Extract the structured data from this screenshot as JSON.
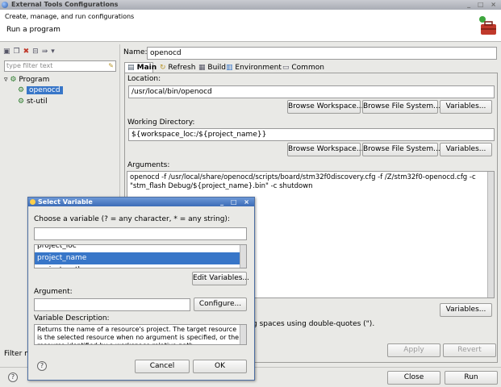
{
  "window": {
    "title": "External Tools Configurations",
    "controls": "_ □ ×"
  },
  "header": {
    "subtitle": "Create, manage, and run configurations",
    "title": "Run a program"
  },
  "left": {
    "filter_placeholder": "type filter text",
    "tree": [
      {
        "label": "Program"
      },
      {
        "label": "openocd"
      },
      {
        "label": "st-util"
      }
    ],
    "filter_status": "Filter m"
  },
  "right": {
    "name_label": "Name:",
    "name_value": "openocd",
    "tabs": [
      "Main",
      "Refresh",
      "Build",
      "Environment",
      "Common"
    ],
    "location_label": "Location:",
    "location_value": "/usr/local/bin/openocd",
    "browse_workspace_1": "Browse Workspace...",
    "browse_fs_1": "Browse File System...",
    "variables_1": "Variables...",
    "workdir_label": "Working Directory:",
    "workdir_value": "${workspace_loc:/${project_name}}",
    "browse_workspace_2": "Browse Workspace...",
    "browse_fs_2": "Browse File System...",
    "variables_2": "Variables...",
    "arguments_label": "Arguments:",
    "arguments_line1": "openocd -f /usr/local/share/openocd/scripts/board/stm32f0discovery.cfg -f  /Z/stm32f0-openocd.cfg -c",
    "arguments_line2": "\"stm_flash  Debug/${project_name}.bin\" -c shutdown",
    "variables_3": "Variables...",
    "quote_note": "g spaces using double-quotes (\").",
    "apply": "Apply",
    "revert": "Revert",
    "close": "Close",
    "run": "Run"
  },
  "dialog": {
    "title": "Select Variable",
    "controls": "_ □ ×",
    "choose_label": "Choose a variable (? = any character, * = any string):",
    "search_value": "",
    "variables": [
      "project_loc",
      "project_name",
      "project_path"
    ],
    "edit_variables": "Edit Variables...",
    "argument_label": "Argument:",
    "argument_value": "",
    "configure": "Configure...",
    "desc_label": "Variable Description:",
    "desc_text": "Returns the name of a resource's project. The target resource is the selected resource when no argument is specified, or the resource identified by a workspace relative path.",
    "cancel": "Cancel",
    "ok": "OK"
  }
}
